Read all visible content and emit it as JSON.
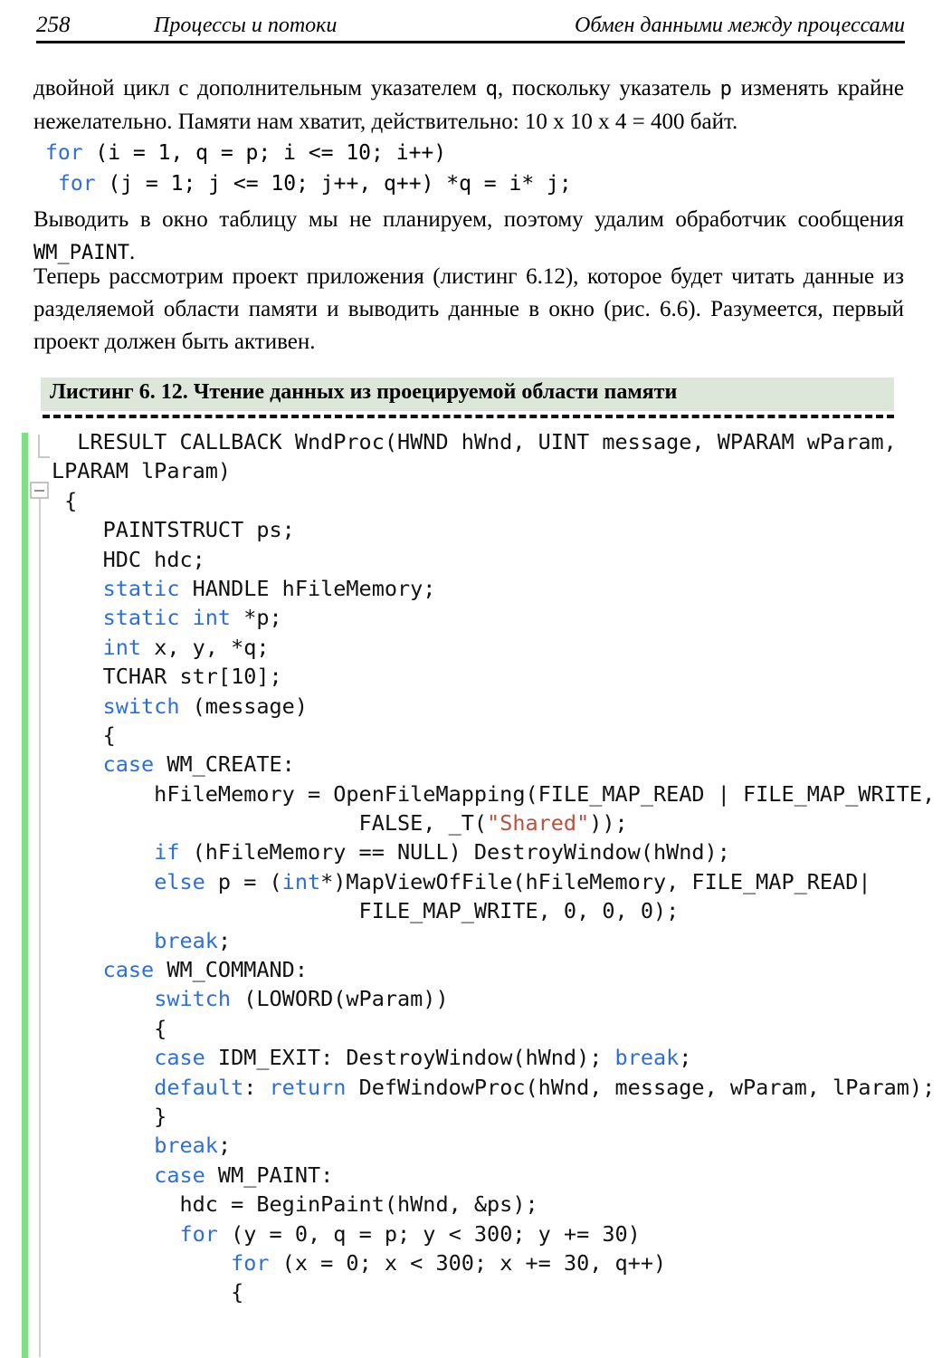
{
  "header": {
    "page_number": "258",
    "chapter_title": "Процессы и потоки",
    "section_title": "Обмен данными между процессами"
  },
  "body": {
    "paragraph_1": "двойной цикл с дополнительным указателем ",
    "paragraph_1_mono_q": "q",
    "paragraph_1_cont": ", поскольку указатель ",
    "paragraph_1_mono_p": "p",
    "paragraph_1_end": " изменять крайне нежелательно. Памяти нам хватит, действительно: 10 x 10 x 4 = 400 байт.",
    "snippet_line_1_kw": "for",
    "snippet_line_1_rest": " (i = 1, q = p; i <= 10; i++)",
    "snippet_line_2_kw": "for",
    "snippet_line_2_rest": " (j = 1; j <= 10; j++, q++) *q = i* j;",
    "paragraph_2": "Выводить в окно таблицу мы не планируем, поэтому удалим обработчик сообщения ",
    "paragraph_2_mono": "WM_PAINT",
    "paragraph_2_end": ".",
    "paragraph_3": " Теперь рассмотрим проект приложения (листинг 6.12), которое будет читать данные из разделяемой области памяти и выводить данные в окно (рис. 6.6). Разумеется, первый проект должен быть активен."
  },
  "listing": {
    "title": "Листинг 6. 12. Чтение данных из проецируемой области памяти",
    "banner_color": "#dce7d9",
    "accent_bar_color": "#7ede86",
    "keyword_color": "#2d6fd8",
    "string_color": "#b5533c",
    "lines": [
      [
        {
          "t": "  LRESULT CALLBACK WndProc(HWND hWnd, UINT message, WPARAM wParam,",
          "c": "plain"
        }
      ],
      [
        {
          "t": "LPARAM lParam)",
          "c": "plain"
        }
      ],
      [
        {
          "t": " {",
          "c": "plain"
        }
      ],
      [
        {
          "t": "    PAINTSTRUCT ps;",
          "c": "plain"
        }
      ],
      [
        {
          "t": "    HDC hdc;",
          "c": "plain"
        }
      ],
      [
        {
          "t": "    ",
          "c": "plain"
        },
        {
          "t": "static",
          "c": "kw"
        },
        {
          "t": " HANDLE hFileMemory;",
          "c": "plain"
        }
      ],
      [
        {
          "t": "    ",
          "c": "plain"
        },
        {
          "t": "static int",
          "c": "kw"
        },
        {
          "t": " *p;",
          "c": "plain"
        }
      ],
      [
        {
          "t": "    ",
          "c": "plain"
        },
        {
          "t": "int",
          "c": "kw"
        },
        {
          "t": " x, y, *q;",
          "c": "plain"
        }
      ],
      [
        {
          "t": "    TCHAR str[10];",
          "c": "plain"
        }
      ],
      [
        {
          "t": "    ",
          "c": "plain"
        },
        {
          "t": "switch",
          "c": "kw"
        },
        {
          "t": " (message)",
          "c": "plain"
        }
      ],
      [
        {
          "t": "    {",
          "c": "plain"
        }
      ],
      [
        {
          "t": "    ",
          "c": "plain"
        },
        {
          "t": "case",
          "c": "kw"
        },
        {
          "t": " WM_CREATE:",
          "c": "plain"
        }
      ],
      [
        {
          "t": "        hFileMemory = OpenFileMapping(FILE_MAP_READ | FILE_MAP_WRITE,",
          "c": "plain"
        }
      ],
      [
        {
          "t": "                        FALSE, _T(",
          "c": "plain"
        },
        {
          "t": "\"Shared\"",
          "c": "str"
        },
        {
          "t": "));",
          "c": "plain"
        }
      ],
      [
        {
          "t": "        ",
          "c": "plain"
        },
        {
          "t": "if",
          "c": "kw"
        },
        {
          "t": " (hFileMemory == NULL) DestroyWindow(hWnd);",
          "c": "plain"
        }
      ],
      [
        {
          "t": "        ",
          "c": "plain"
        },
        {
          "t": "else",
          "c": "kw"
        },
        {
          "t": " p = (",
          "c": "plain"
        },
        {
          "t": "int",
          "c": "kw"
        },
        {
          "t": "*)MapViewOfFile(hFileMemory, FILE_MAP_READ|",
          "c": "plain"
        }
      ],
      [
        {
          "t": "                        FILE_MAP_WRITE, 0, 0, 0);",
          "c": "plain"
        }
      ],
      [
        {
          "t": "        ",
          "c": "plain"
        },
        {
          "t": "break",
          "c": "kw"
        },
        {
          "t": ";",
          "c": "plain"
        }
      ],
      [
        {
          "t": "    ",
          "c": "plain"
        },
        {
          "t": "case",
          "c": "kw"
        },
        {
          "t": " WM_COMMAND:",
          "c": "plain"
        }
      ],
      [
        {
          "t": "        ",
          "c": "plain"
        },
        {
          "t": "switch",
          "c": "kw"
        },
        {
          "t": " (LOWORD(wParam))",
          "c": "plain"
        }
      ],
      [
        {
          "t": "        {",
          "c": "plain"
        }
      ],
      [
        {
          "t": "        ",
          "c": "plain"
        },
        {
          "t": "case",
          "c": "kw"
        },
        {
          "t": " IDM_EXIT: DestroyWindow(hWnd); ",
          "c": "plain"
        },
        {
          "t": "break",
          "c": "kw"
        },
        {
          "t": ";",
          "c": "plain"
        }
      ],
      [
        {
          "t": "        ",
          "c": "plain"
        },
        {
          "t": "default",
          "c": "kw"
        },
        {
          "t": ": ",
          "c": "plain"
        },
        {
          "t": "return",
          "c": "kw"
        },
        {
          "t": " DefWindowProc(hWnd, message, wParam, lParam);",
          "c": "plain"
        }
      ],
      [
        {
          "t": "        }",
          "c": "plain"
        }
      ],
      [
        {
          "t": "        ",
          "c": "plain"
        },
        {
          "t": "break",
          "c": "kw"
        },
        {
          "t": ";",
          "c": "plain"
        }
      ],
      [
        {
          "t": "        ",
          "c": "plain"
        },
        {
          "t": "case",
          "c": "kw"
        },
        {
          "t": " WM_PAINT:",
          "c": "plain"
        }
      ],
      [
        {
          "t": "          hdc = BeginPaint(hWnd, &ps);",
          "c": "plain"
        }
      ],
      [
        {
          "t": "          ",
          "c": "plain"
        },
        {
          "t": "for",
          "c": "kw"
        },
        {
          "t": " (y = 0, q = p; y < 300; y += 30)",
          "c": "plain"
        }
      ],
      [
        {
          "t": "              ",
          "c": "plain"
        },
        {
          "t": "for",
          "c": "kw"
        },
        {
          "t": " (x = 0; x < 300; x += 30, q++)",
          "c": "plain"
        }
      ],
      [
        {
          "t": "              {",
          "c": "plain"
        }
      ]
    ]
  }
}
